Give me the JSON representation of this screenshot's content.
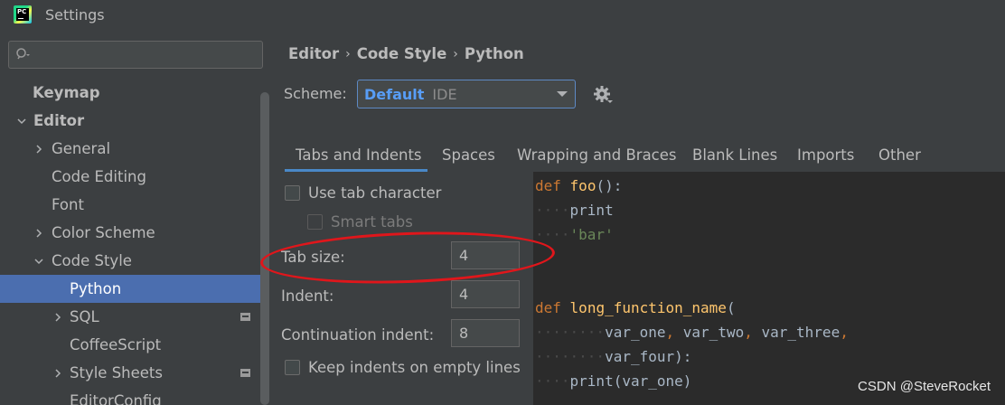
{
  "window": {
    "title": "Settings",
    "app_icon_text": "PC"
  },
  "sidebar": {
    "search": {
      "placeholder": "",
      "value": ""
    },
    "items": [
      {
        "label": "Keymap"
      },
      {
        "label": "Editor"
      },
      {
        "label": "General"
      },
      {
        "label": "Code Editing"
      },
      {
        "label": "Font"
      },
      {
        "label": "Color Scheme"
      },
      {
        "label": "Code Style"
      },
      {
        "label": "Python"
      },
      {
        "label": "SQL"
      },
      {
        "label": "CoffeeScript"
      },
      {
        "label": "Style Sheets"
      },
      {
        "label": "EditorConfig"
      }
    ]
  },
  "breadcrumb": {
    "items": [
      "Editor",
      "Code Style",
      "Python"
    ]
  },
  "scheme": {
    "label": "Scheme:",
    "value": "Default",
    "sublabel": "IDE"
  },
  "tabs": [
    "Tabs and Indents",
    "Spaces",
    "Wrapping and Braces",
    "Blank Lines",
    "Imports",
    "Other"
  ],
  "options": {
    "use_tab": {
      "label": "Use tab character",
      "checked": false
    },
    "smart_tabs": {
      "label": "Smart tabs",
      "checked": false,
      "enabled": false
    },
    "tab_size": {
      "label": "Tab size:",
      "value": "4"
    },
    "indent": {
      "label": "Indent:",
      "value": "4"
    },
    "continuation": {
      "label": "Continuation indent:",
      "value": "8"
    },
    "keep_indents": {
      "label": "Keep indents on empty lines",
      "checked": false
    }
  },
  "code": {
    "l1_kw": "def",
    "l1_fn": "foo",
    "l1_rest": "():",
    "l2_dots": "····",
    "l2_text": "print",
    "l3_dots": "····",
    "l3_str": "'bar'",
    "l4_kw": "def",
    "l4_fn": "long_function_name",
    "l4_rest": "(",
    "l5_dots": "········",
    "l5_a": "var_one",
    "l5_c1": ",",
    "l5_b": "var_two",
    "l5_c2": ",",
    "l5_c": "var_three",
    "l5_c3": ",",
    "l6_dots": "········",
    "l6_a": "var_four",
    "l6_rest": "):",
    "l7_dots": "····",
    "l7_text": "print(var_one)"
  },
  "watermark": "CSDN @SteveRocket",
  "colors": {
    "accent": "#4b6eaf",
    "tab_underline": "#4a88c7",
    "annotation": "#e0161b"
  }
}
